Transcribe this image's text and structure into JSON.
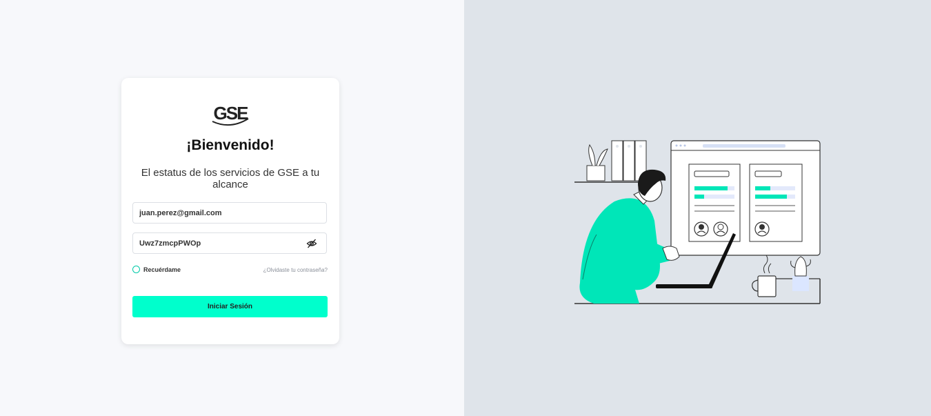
{
  "login_card": {
    "logo_text": "GSE",
    "title": "¡Bienvenido!",
    "subtitle": "El estatus de los servicios de GSE a tu alcance",
    "email_value": "juan.perez@gmail.com",
    "password_value": "Uwz7zmcpPWOp",
    "remember_label": "Recuérdame",
    "forgot_label": "¿Olvidaste tu contraseña?",
    "submit_label": "Iniciar Sesión"
  },
  "icons": {
    "password_toggle": "eye-slash-icon"
  },
  "colors": {
    "accent": "#00ffcc",
    "accent_dark": "#00c9a7",
    "left_bg": "#f7f8fb",
    "right_bg": "#dfe4ea"
  }
}
